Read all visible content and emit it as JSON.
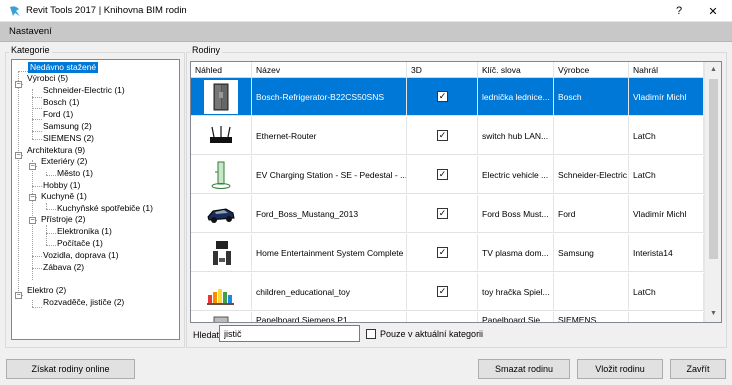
{
  "window": {
    "title": "Revit Tools 2017 | Knihovna BIM rodin",
    "help_label": "?",
    "close_label": "✕"
  },
  "menu": {
    "settings": "Nastavení"
  },
  "categories": {
    "label": "Kategorie",
    "nodes": [
      "Nedávno stažené",
      "Výrobci (5)",
      "Schneider-Electric (1)",
      "Bosch (1)",
      "Ford (1)",
      "Samsung (2)",
      "SIEMENS (2)",
      "Architektura (9)",
      "Exteriéry (2)",
      "Město (1)",
      "Hobby (1)",
      "Kuchyně (1)",
      "Kuchyňské spotřebiče (1)",
      "Přístroje (2)",
      "Elektronika (1)",
      "Počítače (1)",
      "Vozidla, doprava (1)",
      "Zábava (2)",
      "Elektro (2)",
      "Rozvaděče, jističe (2)"
    ]
  },
  "families": {
    "label": "Rodiny",
    "columns": [
      "Náhled",
      "Název",
      "3D",
      "Klíč. slova",
      "Výrobce",
      "Nahrál"
    ],
    "rows": [
      {
        "name": "Bosch-Refrigerator-B22CS50SNS",
        "keywords": "lednička lednice...",
        "maker": "Bosch",
        "uploader": "Vladimír Michl",
        "icon": "refrigerator-icon"
      },
      {
        "name": "Ethernet-Router",
        "keywords": "switch hub LAN...",
        "maker": "",
        "uploader": "LatCh",
        "icon": "router-icon"
      },
      {
        "name": "EV Charging Station - SE - Pedestal - ...",
        "keywords": "Electric vehicle ...",
        "maker": "Schneider-Electric",
        "uploader": "LatCh",
        "icon": "charging-station-icon"
      },
      {
        "name": "Ford_Boss_Mustang_2013",
        "keywords": "Ford Boss Must...",
        "maker": "Ford",
        "uploader": "Vladimír Michl",
        "icon": "car-icon"
      },
      {
        "name": "Home Entertainment System Complete",
        "keywords": "TV plasma dom...",
        "maker": "Samsung",
        "uploader": "Interista14",
        "icon": "entertainment-system-icon"
      },
      {
        "name": "children_educational_toy",
        "keywords": "toy hračka Spiel...",
        "maker": "",
        "uploader": "LatCh",
        "icon": "toy-icon"
      },
      {
        "name": "Panelboard Siemens P1",
        "keywords": "Panelboard Sie...",
        "maker": "SIEMENS",
        "uploader": "",
        "icon": "panelboard-icon"
      }
    ]
  },
  "search": {
    "label": "Hledat",
    "value": "jistič",
    "only_current_label": "Pouze v aktuální kategorii"
  },
  "buttons": {
    "get_online": "Získat rodiny online",
    "delete": "Smazat rodinu",
    "insert": "Vložit rodinu",
    "close": "Zavřít"
  },
  "colors": {
    "selection": "#0078d7",
    "menubar": "#c8c8c8"
  }
}
